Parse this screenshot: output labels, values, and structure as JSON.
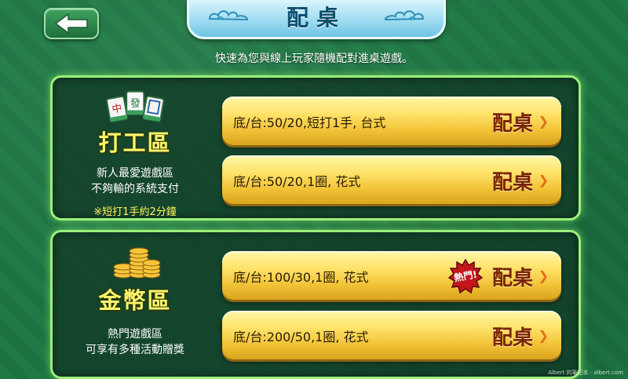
{
  "header": {
    "title": "配桌",
    "subtitle": "快速為您與線上玩家隨機配對進桌遊戲。"
  },
  "zones": [
    {
      "title": "打工區",
      "icon": "mahjong-tiles-icon",
      "desc_line1": "新人最愛遊戲區",
      "desc_line2": "不夠輸的系統支付",
      "note": "※短打1手約2分鐘",
      "options": [
        {
          "label": "底/台:50/20,短打1手, 台式",
          "action": "配桌"
        },
        {
          "label": "底/台:50/20,1圈, 花式",
          "action": "配桌"
        }
      ]
    },
    {
      "title": "金幣區",
      "icon": "gold-coins-icon",
      "desc_line1": "熱門遊戲區",
      "desc_line2": "可享有多種活動贈獎",
      "options": [
        {
          "label": "底/台:100/30,1圈, 花式",
          "action": "配桌",
          "badge": "熱門!"
        },
        {
          "label": "底/台:200/50,1圈, 花式",
          "action": "配桌"
        }
      ]
    }
  ],
  "watermark": "Albert 的筆記本 · albert.com"
}
